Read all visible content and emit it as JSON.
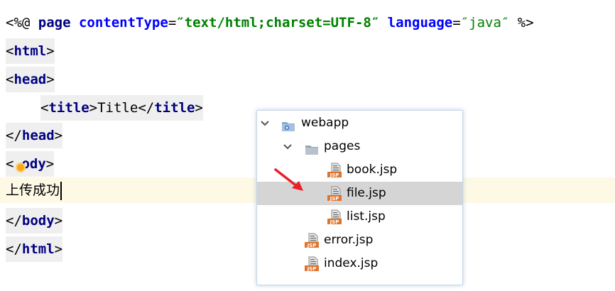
{
  "editor": {
    "lines": {
      "directive": {
        "open": "<%@ ",
        "keyword": "page",
        "attr1": "contentType",
        "eq1": "=",
        "val1": "″text/html;charset=UTF-8″",
        "attr2": "language",
        "eq2": "=",
        "val2": "″java″",
        "close": " %>"
      },
      "html_open": "html",
      "head_open": "head",
      "title_tag": "title",
      "title_text": "Title",
      "head_close": "head",
      "body_open": "body",
      "body_open_visible": "ody",
      "body_content": "上传成功",
      "body_close": "body",
      "html_close": "html"
    }
  },
  "tree": {
    "root": {
      "label": "webapp",
      "icon": "web-folder-icon",
      "expanded": true
    },
    "pages": {
      "label": "pages",
      "icon": "folder-icon",
      "expanded": true
    },
    "files": [
      {
        "label": "book.jsp",
        "icon": "jsp-file-icon",
        "selected": false
      },
      {
        "label": "file.jsp",
        "icon": "jsp-file-icon",
        "selected": true
      },
      {
        "label": "list.jsp",
        "icon": "jsp-file-icon",
        "selected": false
      }
    ],
    "root_files": [
      {
        "label": "error.jsp",
        "icon": "jsp-file-icon"
      },
      {
        "label": "index.jsp",
        "icon": "jsp-file-icon"
      }
    ],
    "jsp_badge": "JSP"
  },
  "colors": {
    "tag": "#000080",
    "attribute": "#0000ff",
    "string": "#008000",
    "current_line": "#fdf9e5",
    "selection": "#d5d5d5",
    "annotation_arrow": "#e8202a"
  }
}
